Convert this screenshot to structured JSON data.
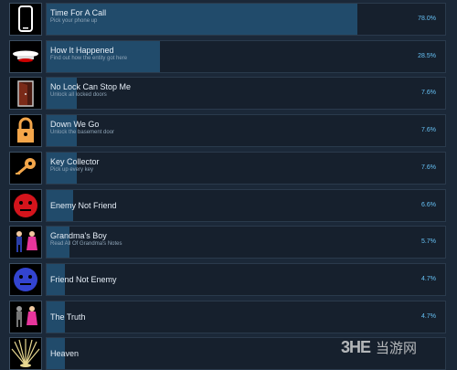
{
  "achievements": [
    {
      "title": "Time For A Call",
      "description": "Pick your phone up",
      "percent": "78.0%",
      "fill": 0.78,
      "icon": "phone-icon"
    },
    {
      "title": "How It Happened",
      "description": "Find out how the entity got here",
      "percent": "28.5%",
      "fill": 0.285,
      "icon": "ufo-icon"
    },
    {
      "title": "No Lock Can Stop Me",
      "description": "Unlock all locked doors",
      "percent": "7.6%",
      "fill": 0.076,
      "icon": "door-icon"
    },
    {
      "title": "Down We Go",
      "description": "Unlock the basement door",
      "percent": "7.6%",
      "fill": 0.076,
      "icon": "padlock-icon"
    },
    {
      "title": "Key Collector",
      "description": "Pick up every key",
      "percent": "7.6%",
      "fill": 0.076,
      "icon": "key-icon"
    },
    {
      "title": "Enemy Not Friend",
      "description": "",
      "percent": "6.6%",
      "fill": 0.066,
      "icon": "red-face-icon"
    },
    {
      "title": "Grandma's Boy",
      "description": "Read All Of Grandma's Notes",
      "percent": "5.7%",
      "fill": 0.057,
      "icon": "boy-and-grandma-icon"
    },
    {
      "title": "Friend Not Enemy",
      "description": "",
      "percent": "4.7%",
      "fill": 0.047,
      "icon": "blue-face-icon"
    },
    {
      "title": "The Truth",
      "description": "",
      "percent": "4.7%",
      "fill": 0.047,
      "icon": "figures-icon"
    },
    {
      "title": "Heaven",
      "description": "",
      "percent": "",
      "fill": 0.047,
      "icon": "light-rays-icon"
    }
  ],
  "watermark": {
    "logo": "3HE",
    "text": "当游网"
  }
}
